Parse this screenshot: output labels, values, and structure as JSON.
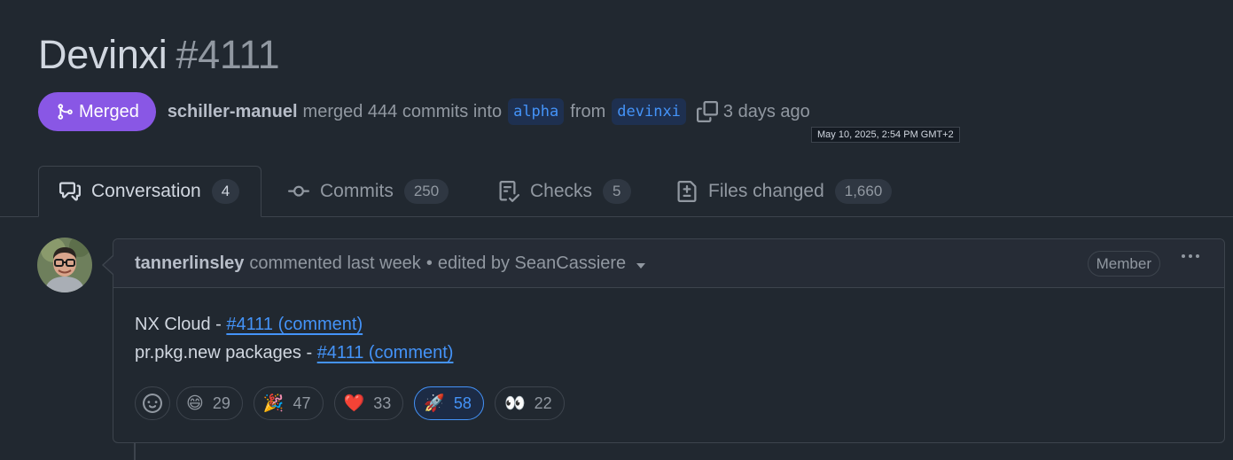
{
  "pr": {
    "title": "Devinxi",
    "number": "#4111",
    "status": "Merged",
    "author": "schiller-manuel",
    "action": "merged 444 commits into",
    "base_branch": "alpha",
    "from_word": "from",
    "head_branch": "devinxi",
    "time": "3 days ago",
    "tooltip": "May 10, 2025, 2:54 PM GMT+2"
  },
  "tabs": [
    {
      "label": "Conversation",
      "count": "4",
      "icon": "conversation-icon",
      "active": true
    },
    {
      "label": "Commits",
      "count": "250",
      "icon": "commit-icon",
      "active": false
    },
    {
      "label": "Checks",
      "count": "5",
      "icon": "checklist-icon",
      "active": false
    },
    {
      "label": "Files changed",
      "count": "1,660",
      "icon": "file-diff-icon",
      "active": false
    }
  ],
  "comment": {
    "author": "tannerlinsley",
    "meta": "commented last week",
    "edited": "edited by SeanCassiere",
    "role": "Member",
    "lines": [
      {
        "prefix": "NX Cloud - ",
        "link": "#4111 (comment)"
      },
      {
        "prefix": "pr.pkg.new packages - ",
        "link": "#4111 (comment)"
      }
    ],
    "reactions": [
      {
        "emoji": "😄",
        "count": "29",
        "selected": false
      },
      {
        "emoji": "🎉",
        "count": "47",
        "selected": false
      },
      {
        "emoji": "❤️",
        "count": "33",
        "selected": false
      },
      {
        "emoji": "🚀",
        "count": "58",
        "selected": true
      },
      {
        "emoji": "👀",
        "count": "22",
        "selected": false
      }
    ]
  },
  "colors": {
    "background": "#212830",
    "merged": "#8957e5",
    "link": "#4493f8",
    "border": "#3d444d"
  }
}
